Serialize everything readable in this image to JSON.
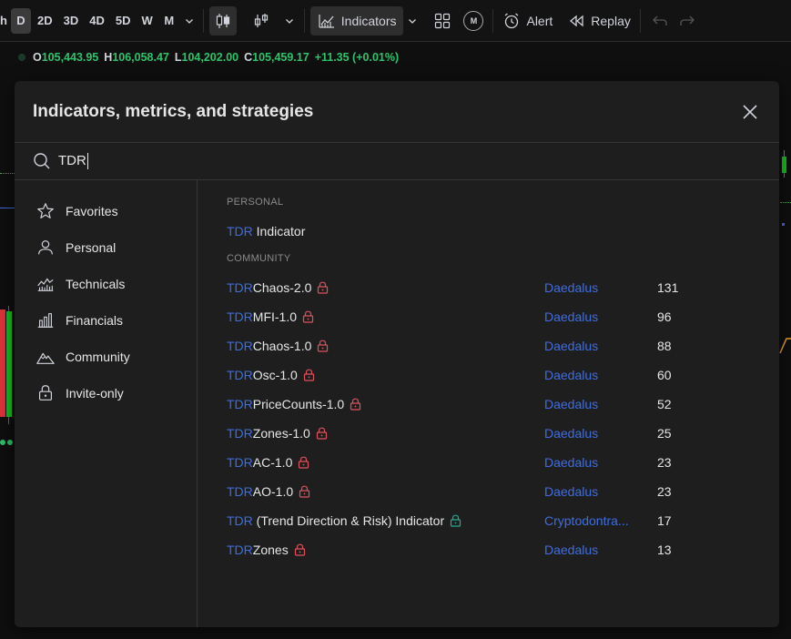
{
  "toolbar": {
    "timeframes": [
      {
        "label": "h",
        "active": false
      },
      {
        "label": "D",
        "active": true
      },
      {
        "label": "2D",
        "active": false
      },
      {
        "label": "3D",
        "active": false
      },
      {
        "label": "4D",
        "active": false
      },
      {
        "label": "5D",
        "active": false
      },
      {
        "label": "W",
        "active": false
      },
      {
        "label": "M",
        "active": false
      }
    ],
    "indicators_label": "Indicators",
    "alert_label": "Alert",
    "replay_label": "Replay",
    "m_badge": "M"
  },
  "ohlc": {
    "o_key": "O",
    "o_val": "105,443.95",
    "h_key": "H",
    "h_val": "106,058.47",
    "l_key": "L",
    "l_val": "104,202.00",
    "c_key": "C",
    "c_val": "105,459.17",
    "change": "+11.35 (+0.01%)"
  },
  "dialog": {
    "title": "Indicators, metrics, and strategies",
    "search_value": "TDR",
    "sidebar": [
      {
        "label": "Favorites",
        "icon": "star-icon"
      },
      {
        "label": "Personal",
        "icon": "person-icon"
      },
      {
        "label": "Technicals",
        "icon": "technicals-icon"
      },
      {
        "label": "Financials",
        "icon": "bar-chart-icon"
      },
      {
        "label": "Community",
        "icon": "community-icon"
      },
      {
        "label": "Invite-only",
        "icon": "lock-icon"
      }
    ],
    "personal_heading": "PERSONAL",
    "personal_items": [
      {
        "highlight": "TDR",
        "rest": " Indicator"
      }
    ],
    "community_heading": "COMMUNITY",
    "community_items": [
      {
        "highlight": "TDR",
        "rest": "Chaos-2.0",
        "lock": "red",
        "author": "Daedalus",
        "count": "131"
      },
      {
        "highlight": "TDR",
        "rest": "MFI-1.0",
        "lock": "red",
        "author": "Daedalus",
        "count": "96"
      },
      {
        "highlight": "TDR",
        "rest": "Chaos-1.0",
        "lock": "red",
        "author": "Daedalus",
        "count": "88"
      },
      {
        "highlight": "TDR",
        "rest": "Osc-1.0",
        "lock": "red",
        "author": "Daedalus",
        "count": "60"
      },
      {
        "highlight": "TDR",
        "rest": "PriceCounts-1.0",
        "lock": "red",
        "author": "Daedalus",
        "count": "52"
      },
      {
        "highlight": "TDR",
        "rest": "Zones-1.0",
        "lock": "red",
        "author": "Daedalus",
        "count": "25"
      },
      {
        "highlight": "TDR",
        "rest": "AC-1.0",
        "lock": "red",
        "author": "Daedalus",
        "count": "23"
      },
      {
        "highlight": "TDR",
        "rest": "AO-1.0",
        "lock": "red",
        "author": "Daedalus",
        "count": "23"
      },
      {
        "highlight": "TDR",
        "rest": " (Trend Direction & Risk) Indicator",
        "lock": "green",
        "author": "Cryptodontra...",
        "count": "17"
      },
      {
        "highlight": "TDR",
        "rest": "Zones",
        "lock": "red",
        "author": "Daedalus",
        "count": "13"
      }
    ]
  },
  "colors": {
    "accent_blue": "#3d6ee0",
    "lock_red": "#e0515b",
    "lock_green": "#22ab94",
    "price_green": "#2ec26a"
  }
}
